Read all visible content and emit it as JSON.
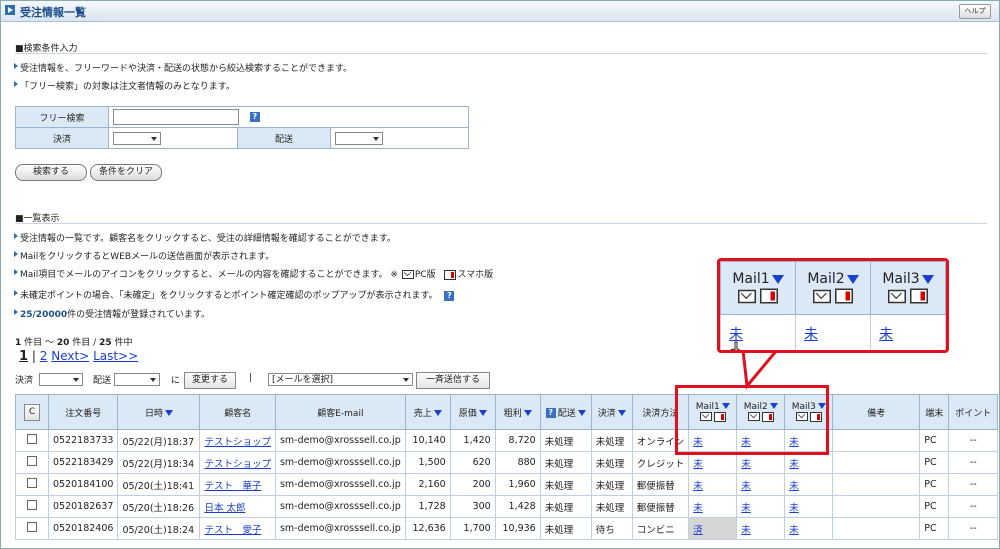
{
  "window": {
    "title": "受注情報一覧",
    "help_label": "ヘルプ"
  },
  "search": {
    "heading": "■検索条件入力",
    "notes": [
      "受注情報を、フリーワードや決済・配送の状態から絞込検索することができます。",
      "「フリー検索」の対象は注文者情報のみとなります。"
    ],
    "free_label": "フリー検索",
    "free_value": "",
    "payment_label": "決済",
    "shipping_label": "配送",
    "search_button": "検索する",
    "clear_button": "条件をクリア"
  },
  "list": {
    "heading": "■一覧表示",
    "notes": [
      "受注情報の一覧です。顧客名をクリックすると、受注の詳細情報を確認することができます。",
      "MailをクリックするとWEBメールの送信画面が表示されます。",
      "Mail項目でメールのアイコンをクリックすると、メールの内容を確認することができます。 ※",
      "未確定ポイントの場合、「未確定」をクリックするとポイント確定確認のポップアップが表示されます。"
    ],
    "pc_label": "PC版",
    "sp_label": "スマホ版",
    "registered_count": "25/20000",
    "registered_suffix": "件の受注情報が登録されています。",
    "range_prefix": "1",
    "range_from_to": "件目 〜",
    "range_to": "20",
    "range_mid": "件目 /",
    "range_total": "25",
    "range_suffix": "件中",
    "pager": {
      "current": "1",
      "sep": "|",
      "page2": "2",
      "next": "Next>",
      "last": "Last>>"
    },
    "toolbar": {
      "payment_label": "決済",
      "shipping_label": "配送",
      "ni": "に",
      "change_button": "変更する",
      "divider": "|",
      "mail_select": "[メールを選択]",
      "bulk_send_button": "一斉送信する"
    },
    "columns": {
      "check": "C",
      "order_no": "注文番号",
      "datetime": "日時",
      "customer": "顧客名",
      "email": "顧客E-mail",
      "sales": "売上",
      "cost": "原価",
      "profit": "粗利",
      "shipping": "配送",
      "payment": "決済",
      "method": "決済方法",
      "mail1": "Mail1",
      "mail2": "Mail2",
      "mail3": "Mail3",
      "remarks": "備考",
      "device": "端末",
      "points": "ポイント"
    },
    "rows": [
      {
        "order_no": "0522183733",
        "datetime": "05/22(月)18:37",
        "customer": "テストショップ",
        "email": "sm-demo@xrosssell.co.jp",
        "sales": "10,140",
        "cost": "1,420",
        "profit": "8,720",
        "shipping": "未処理",
        "payment": "未処理",
        "method": "オンライン",
        "mail1": "未",
        "mail2": "未",
        "mail3": "未",
        "device": "PC",
        "points": "--"
      },
      {
        "order_no": "0522183429",
        "datetime": "05/22(月)18:34",
        "customer": "テストショップ",
        "email": "sm-demo@xrosssell.co.jp",
        "sales": "1,500",
        "cost": "620",
        "profit": "880",
        "shipping": "未処理",
        "payment": "未処理",
        "method": "クレジット",
        "mail1": "未",
        "mail2": "未",
        "mail3": "未",
        "device": "PC",
        "points": "--"
      },
      {
        "order_no": "0520184100",
        "datetime": "05/20(土)18:41",
        "customer": "テスト　華子",
        "email": "sm-demo@xrosssell.co.jp",
        "sales": "2,160",
        "cost": "200",
        "profit": "1,960",
        "shipping": "未処理",
        "payment": "未処理",
        "method": "郵便振替",
        "mail1": "未",
        "mail2": "未",
        "mail3": "未",
        "device": "PC",
        "points": "--"
      },
      {
        "order_no": "0520182637",
        "datetime": "05/20(土)18:26",
        "customer": "日本 太郎",
        "email": "sm-demo@xrosssell.co.jp",
        "sales": "1,728",
        "cost": "300",
        "profit": "1,428",
        "shipping": "未処理",
        "payment": "未処理",
        "method": "郵便振替",
        "mail1": "未",
        "mail2": "未",
        "mail3": "未",
        "device": "PC",
        "points": "--"
      },
      {
        "order_no": "0520182406",
        "datetime": "05/20(土)18:24",
        "customer": "テスト　愛子",
        "email": "sm-demo@xrosssell.co.jp",
        "sales": "12,636",
        "cost": "1,700",
        "profit": "10,936",
        "shipping": "未処理",
        "payment": "待ち",
        "method": "コンビニ",
        "mail1": "済",
        "mail2": "未",
        "mail3": "未",
        "device": "PC",
        "points": "--"
      }
    ]
  },
  "callout": {
    "mail1": "Mail1",
    "mail2": "Mail2",
    "mail3": "Mail3",
    "v1": "未",
    "v2": "未",
    "v3": "未"
  },
  "colors": {
    "accent": "#2e6db2",
    "header_bg": "#dbe8f6",
    "highlight": "#e0101e",
    "link": "#1a3fcc"
  }
}
